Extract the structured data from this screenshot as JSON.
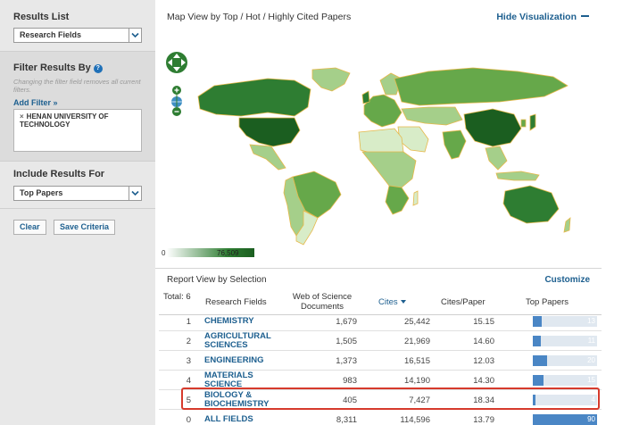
{
  "sidebar": {
    "results_list": {
      "title": "Results List",
      "selected": "Research Fields"
    },
    "filter": {
      "title": "Filter Results By",
      "help": "?",
      "hint": "Changing the filter field removes all current filters.",
      "add_filter": "Add Filter »",
      "chips": [
        {
          "label": "HENAN UNIVERSITY OF TECHNOLOGY"
        }
      ]
    },
    "include": {
      "title": "Include Results For",
      "selected": "Top Papers"
    },
    "buttons": {
      "clear": "Clear",
      "save": "Save Criteria"
    }
  },
  "map": {
    "title": "Map View by Top / Hot / Highly Cited Papers",
    "hide_label": "Hide Visualization",
    "legend": {
      "min": "0",
      "max": "76,509"
    },
    "colors": {
      "darkest": "#1b5e20",
      "dark": "#2e7d32",
      "mid": "#66a84a",
      "light": "#a5cf8a",
      "lightest": "#d8ecc8",
      "border": "#e6b84a",
      "ocean": "#ffffff"
    }
  },
  "report": {
    "title": "Report View by Selection",
    "customize": "Customize",
    "headers": {
      "total": "Total: 6",
      "fields": "Research Fields",
      "wos": "Web of Science Documents",
      "cites": "Cites",
      "cpp": "Cites/Paper",
      "top": "Top Papers"
    },
    "rows": [
      {
        "rank": "1",
        "field": "CHEMISTRY",
        "wos": "1,679",
        "cites": "25,442",
        "cpp": "15.15",
        "top": "13",
        "top_value": 13
      },
      {
        "rank": "2",
        "field": "AGRICULTURAL SCIENCES",
        "wos": "1,505",
        "cites": "21,969",
        "cpp": "14.60",
        "top": "11",
        "top_value": 11
      },
      {
        "rank": "3",
        "field": "ENGINEERING",
        "wos": "1,373",
        "cites": "16,515",
        "cpp": "12.03",
        "top": "20",
        "top_value": 20
      },
      {
        "rank": "4",
        "field": "MATERIALS SCIENCE",
        "wos": "983",
        "cites": "14,190",
        "cpp": "14.30",
        "top": "15",
        "top_value": 15
      },
      {
        "rank": "5",
        "field": "BIOLOGY & BIOCHEMISTRY",
        "wos": "405",
        "cites": "7,427",
        "cpp": "18.34",
        "top": "4",
        "top_value": 4
      },
      {
        "rank": "0",
        "field": "ALL FIELDS",
        "wos": "8,311",
        "cites": "114,596",
        "cpp": "13.79",
        "top": "90",
        "top_value": 90
      }
    ],
    "highlighted_row": "BIOLOGY & BIOCHEMISTRY"
  }
}
